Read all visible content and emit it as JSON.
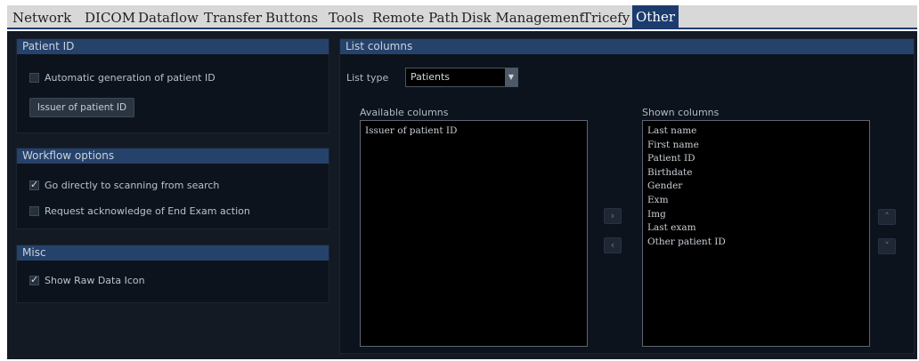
{
  "tabs": [
    {
      "label": "Network",
      "active": false
    },
    {
      "label": "DICOM",
      "active": false
    },
    {
      "label": "Dataflow",
      "active": false
    },
    {
      "label": "Transfer",
      "active": false
    },
    {
      "label": "Buttons",
      "active": false
    },
    {
      "label": "Tools",
      "active": false
    },
    {
      "label": "Remote Path",
      "active": false
    },
    {
      "label": "Disk Management",
      "active": false
    },
    {
      "label": "Tricefy",
      "active": false
    },
    {
      "label": "Other",
      "active": true
    }
  ],
  "patient_id": {
    "title": "Patient ID",
    "auto_generate": {
      "label": "Automatic generation of patient ID",
      "checked": false
    },
    "issuer_button": "Issuer of patient ID"
  },
  "workflow": {
    "title": "Workflow options",
    "go_scan": {
      "label": "Go directly to scanning from search",
      "checked": true
    },
    "request_ack": {
      "label": "Request acknowledge of End Exam action",
      "checked": false
    }
  },
  "misc": {
    "title": "Misc",
    "show_raw": {
      "label": "Show Raw Data Icon",
      "checked": true
    }
  },
  "list_columns": {
    "title": "List columns",
    "list_type_label": "List type",
    "list_type_value": "Patients",
    "available_label": "Available columns",
    "available": [
      "Issuer of patient ID"
    ],
    "shown_label": "Shown columns",
    "shown": [
      "Last name",
      "First name",
      "Patient ID",
      "Birthdate",
      "Gender",
      "Exm",
      "Img",
      "Last exam",
      "Other patient ID"
    ]
  },
  "icons": {
    "add": "chevron-right-icon",
    "remove": "chevron-left-icon",
    "move_up": "chevron-up-icon",
    "move_down": "chevron-down-icon",
    "dropdown": "caret-down-icon"
  },
  "colors": {
    "accent": "#1c3c6e",
    "panel_header": "#25426b",
    "background": "#131a24"
  }
}
